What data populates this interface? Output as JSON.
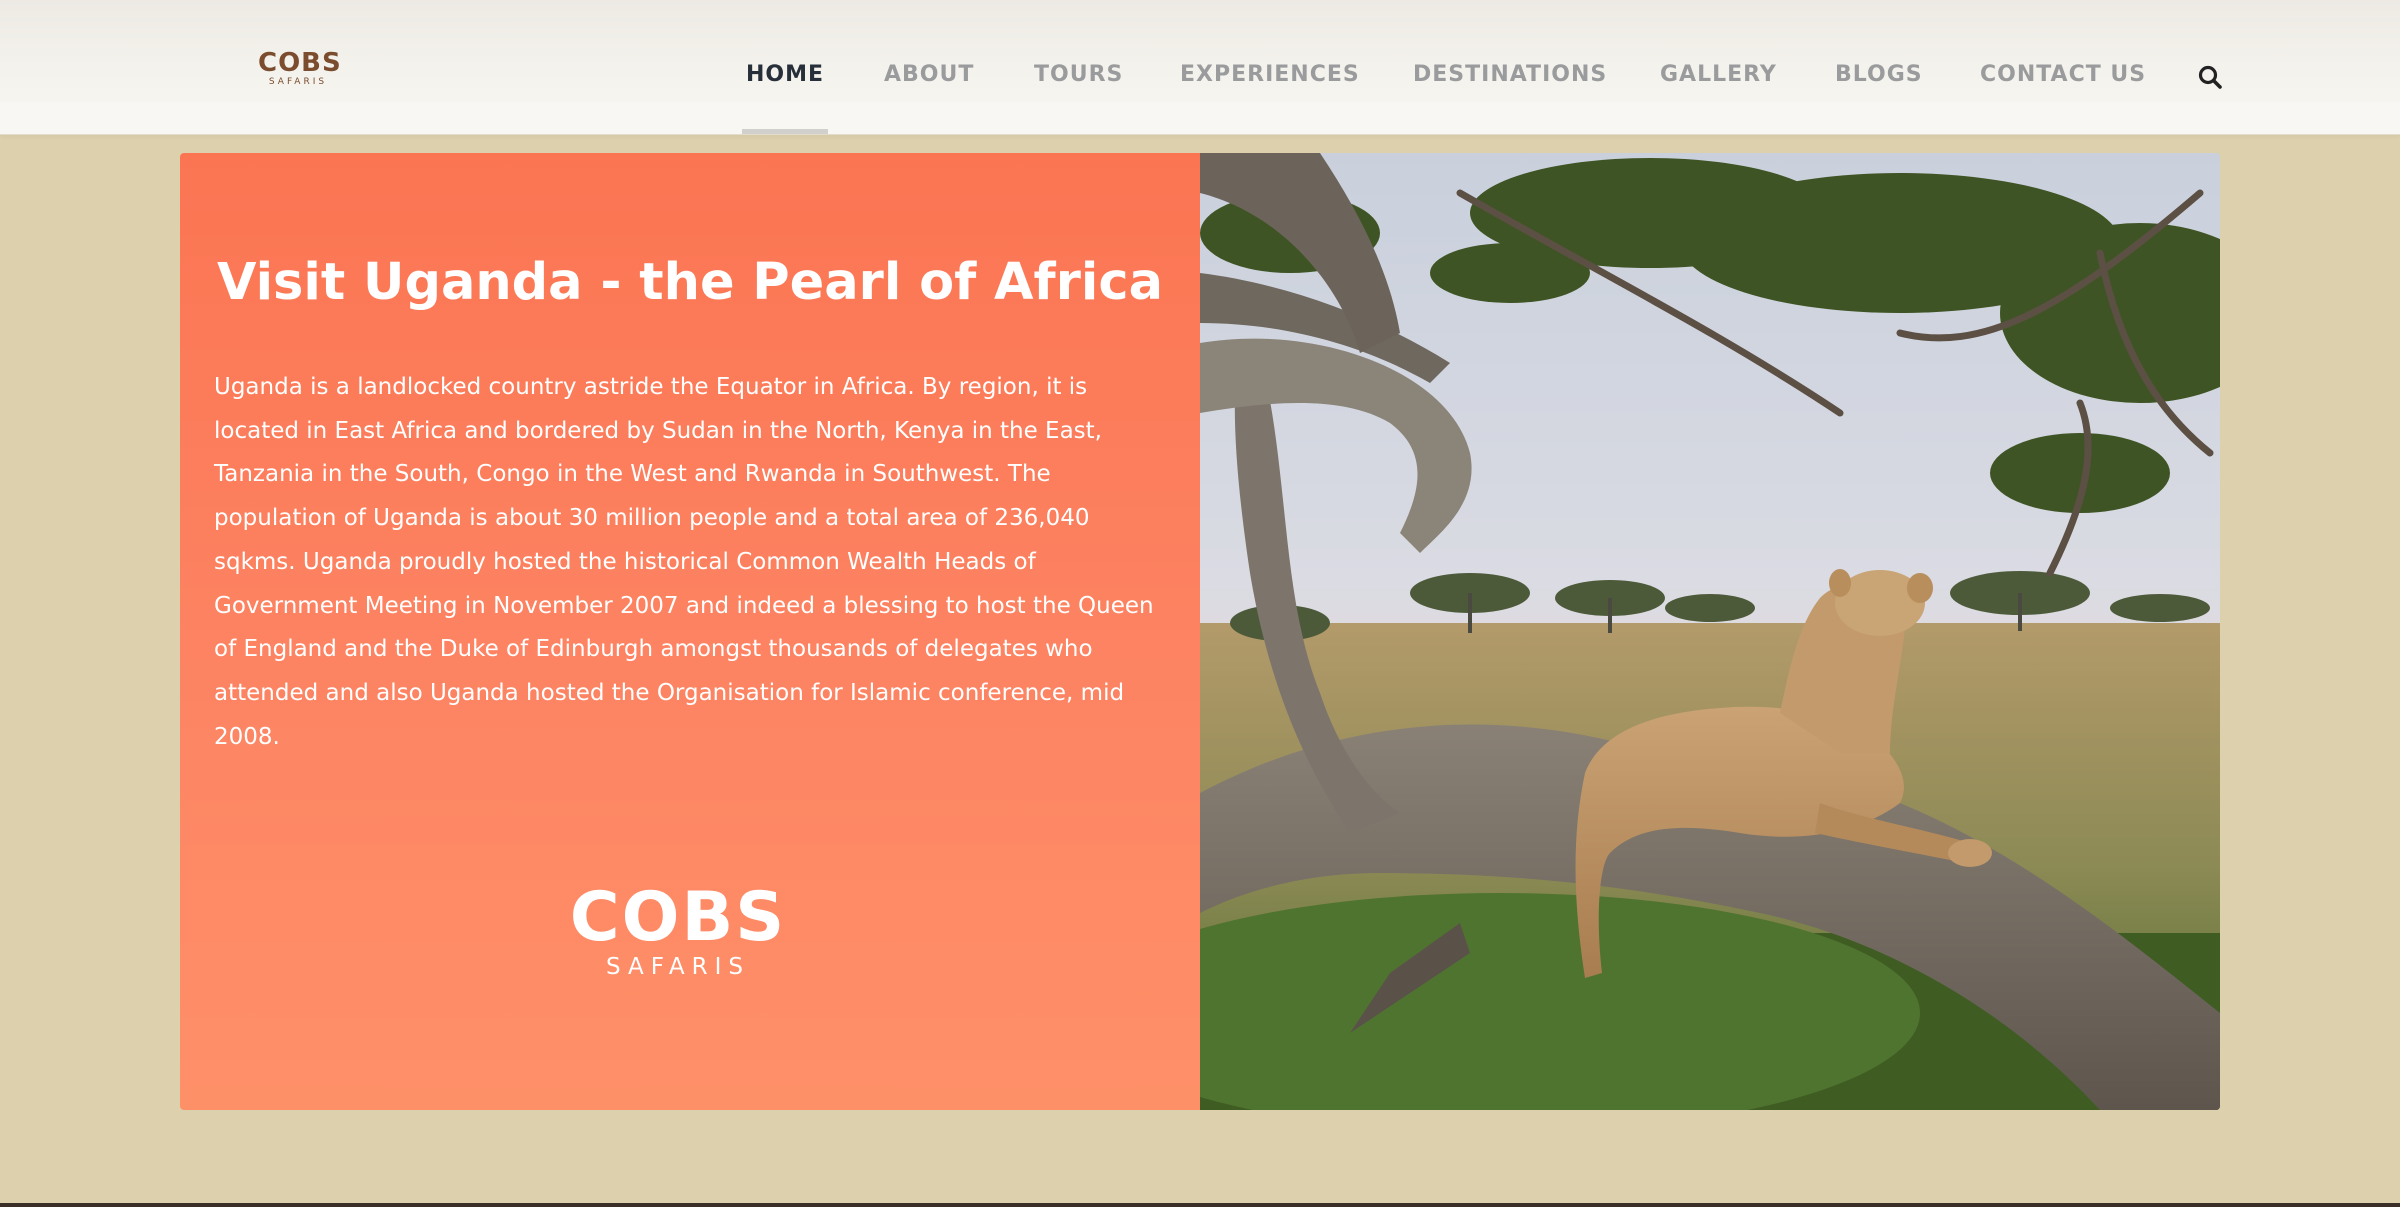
{
  "header": {
    "logo": {
      "brand": "COBS",
      "sub": "SAFARIS"
    },
    "nav": [
      {
        "label": "HOME",
        "active": true
      },
      {
        "label": "ABOUT",
        "active": false
      },
      {
        "label": "TOURS",
        "active": false
      },
      {
        "label": "EXPERIENCES",
        "active": false
      },
      {
        "label": "DESTINATIONS",
        "active": false
      },
      {
        "label": "GALLERY",
        "active": false
      },
      {
        "label": "BLOGS",
        "active": false
      },
      {
        "label": "CONTACT US",
        "active": false
      }
    ],
    "search_icon": "search-icon"
  },
  "hero": {
    "title": "Visit Uganda - the Pearl of Africa",
    "body": "Uganda is a landlocked country astride the Equator in Africa. By region, it is located in East Africa and bordered by Sudan in the North, Kenya in the East, Tanzania in the South, Congo in the West and Rwanda in Southwest. The population of Uganda is about 30 million people and a total area of 236,040 sqkms. Uganda proudly hosted the historical Common Wealth Heads of Government Meeting in November 2007 and indeed a blessing to host the Queen of England and the Duke of Edinburgh amongst thousands of delegates who attended and also Uganda hosted the Organisation for Islamic conference, mid 2008.",
    "logo": {
      "brand": "COBS",
      "sub": "SAFARIS"
    },
    "image": "lioness-on-tree-photo"
  },
  "colors": {
    "accent": "#fb7552",
    "page_background": "#ddd0ad",
    "nav_active": "#27303a",
    "nav_inactive": "#9a9b9d",
    "logo_brown": "#7b4d2e"
  }
}
